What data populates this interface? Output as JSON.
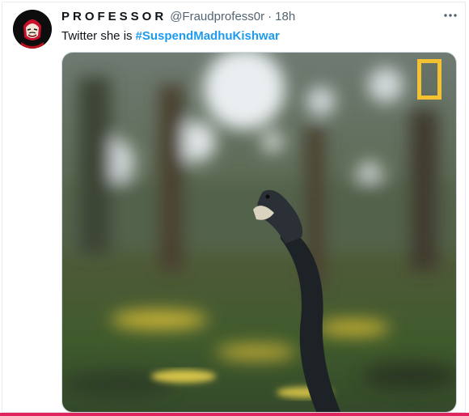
{
  "tweet": {
    "display_name": "PROFESSOR",
    "handle": "@Fraudprofess0r",
    "separator": "·",
    "time": "18h",
    "text": "Twitter she is",
    "hashtag": "#SuspendMadhuKishwar",
    "more_icon": "more-horizontal-icon"
  },
  "media": {
    "logo": "national-geographic-logo",
    "subject": "snake video thumbnail"
  },
  "colors": {
    "hashtag": "#1d9bf0",
    "name": "#0f1419",
    "meta": "#536471",
    "logo": "#f2c230"
  }
}
